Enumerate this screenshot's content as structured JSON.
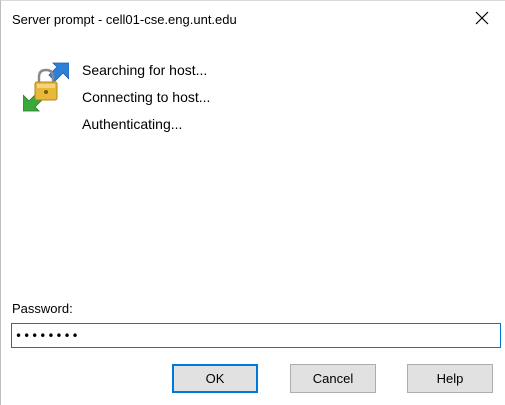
{
  "window": {
    "title": "Server prompt - cell01-cse.eng.unt.edu"
  },
  "icons": {
    "close": "close-icon",
    "status": "connection-arrows-lock-icon"
  },
  "status": {
    "lines": [
      "Searching for host...",
      "Connecting to host...",
      "Authenticating..."
    ]
  },
  "password": {
    "label": "Password:",
    "value": "••••••••"
  },
  "buttons": {
    "ok": "OK",
    "cancel": "Cancel",
    "help": "Help"
  },
  "colors": {
    "focus_border": "#0078d7",
    "button_face": "#e1e1e1",
    "arrow_blue": "#2f7fd8",
    "arrow_green": "#3ba83b",
    "lock_gold": "#e8b83a"
  }
}
